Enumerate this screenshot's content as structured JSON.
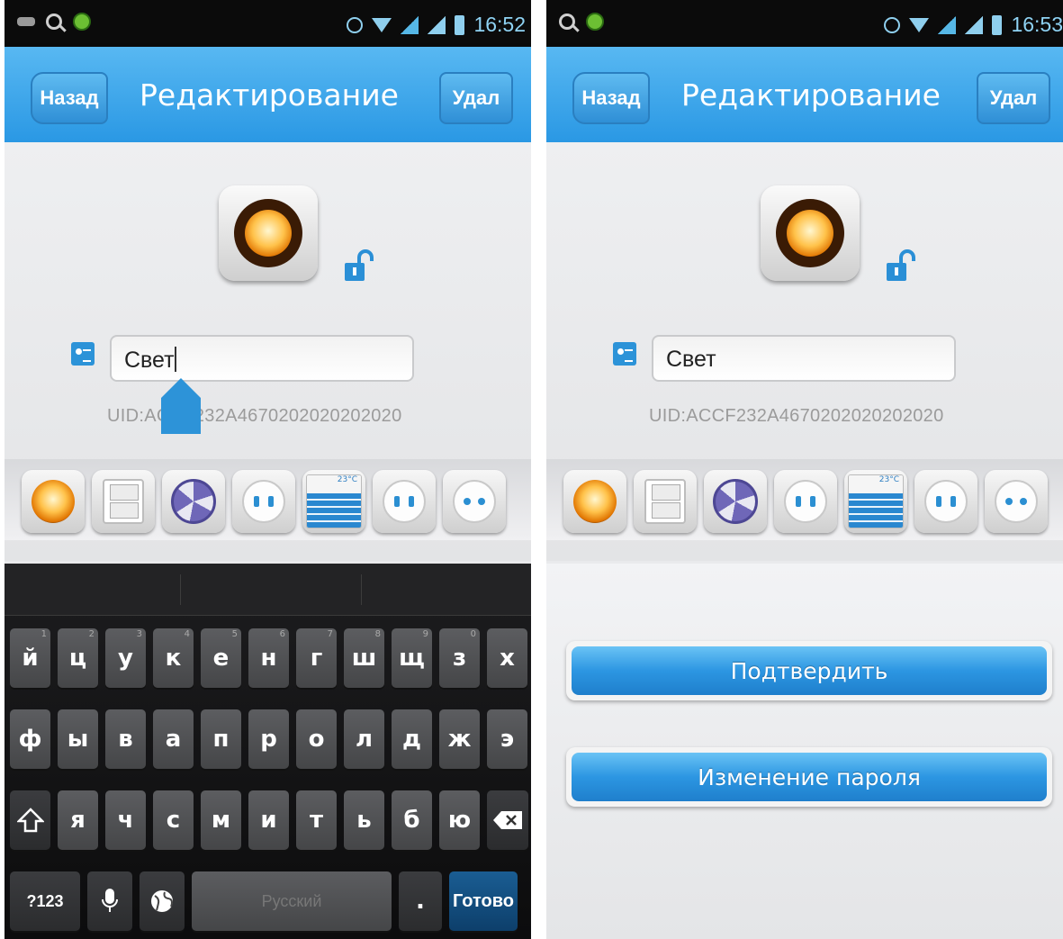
{
  "screens": [
    {
      "status": {
        "time": "16:52"
      },
      "nav": {
        "back": "Назад",
        "title": "Редактирование",
        "delete": "Удал"
      },
      "name_value": "Свет",
      "uid": "UID:ACCF232A4670202020202020",
      "keyboard": {
        "row1": [
          "й",
          "ц",
          "у",
          "к",
          "е",
          "н",
          "г",
          "ш",
          "щ",
          "з",
          "х"
        ],
        "row1_hints": [
          "1",
          "2",
          "3",
          "4",
          "5",
          "6",
          "7",
          "8",
          "9",
          "0",
          ""
        ],
        "row2": [
          "ф",
          "ы",
          "в",
          "а",
          "п",
          "р",
          "о",
          "л",
          "д",
          "ж",
          "э"
        ],
        "row3": [
          "я",
          "ч",
          "с",
          "м",
          "и",
          "т",
          "ь",
          "б",
          "ю"
        ],
        "symbols": "?123",
        "space": "Русский",
        "period": ".",
        "done": "Готово"
      }
    },
    {
      "status": {
        "time": "16:53"
      },
      "nav": {
        "back": "Назад",
        "title": "Редактирование",
        "delete": "Удал"
      },
      "name_value": "Свет",
      "uid": "UID:ACCF232A4670202020202020",
      "buttons": {
        "confirm": "Подтвердить",
        "change_password": "Изменение пароля"
      }
    }
  ],
  "device_types": [
    "light",
    "switch",
    "fan",
    "outlet",
    "air-conditioner",
    "socket",
    "plug"
  ],
  "ac_temp": "23°C",
  "colors": {
    "nav_blue": "#2a98e4",
    "status_bg": "#0b0b0b",
    "status_text": "#8fd3f4"
  }
}
